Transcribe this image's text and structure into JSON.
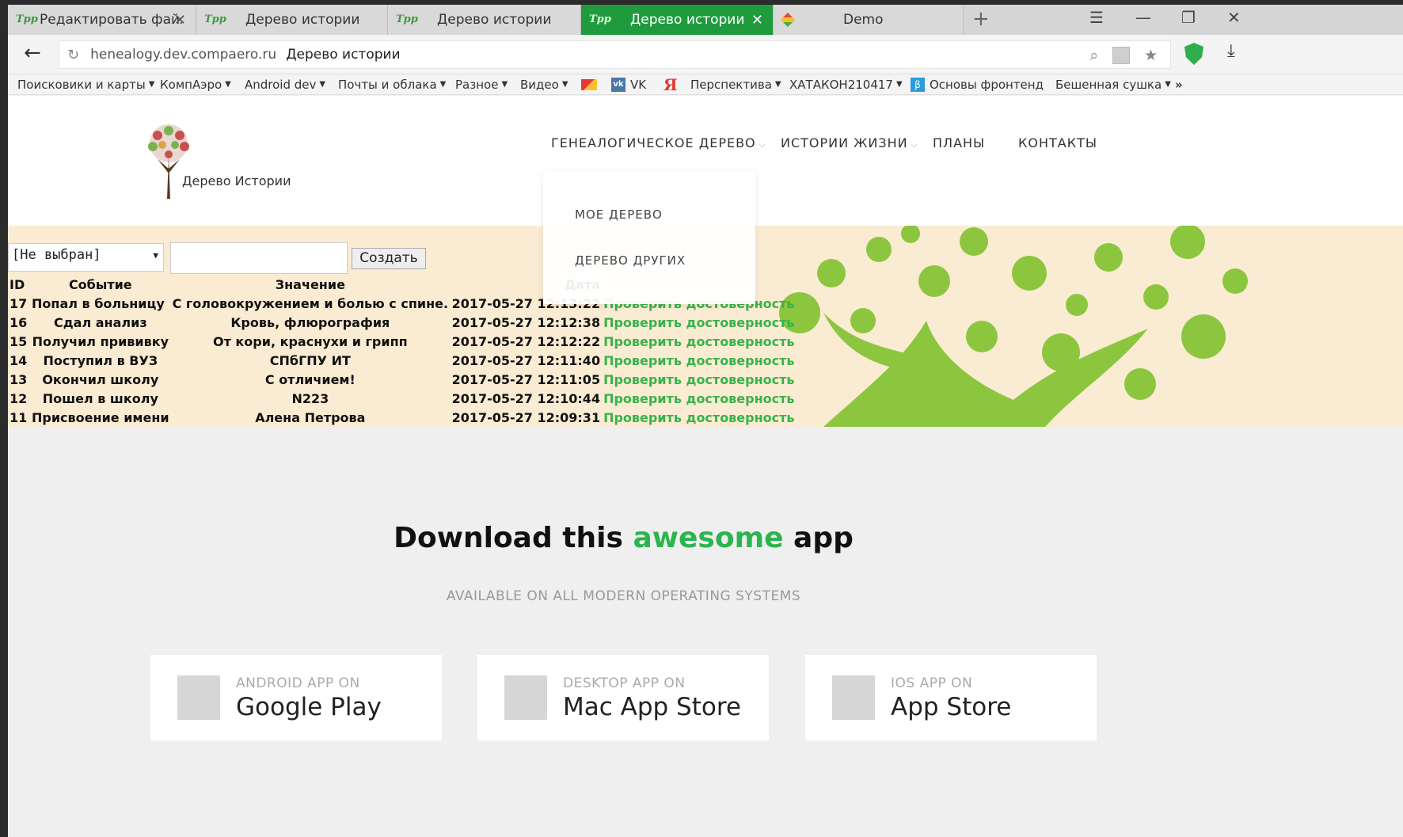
{
  "browser": {
    "tabs": [
      {
        "title": "Редактировать файл: styl",
        "closable": true
      },
      {
        "title": "Дерево истории",
        "closable": false
      },
      {
        "title": "Дерево истории",
        "closable": false
      },
      {
        "title": "Дерево истории",
        "closable": true,
        "active": true
      },
      {
        "title": "Demo",
        "closable": false
      }
    ],
    "url_domain": "henealogy.dev.compaero.ru",
    "url_title": "Дерево истории",
    "bookmarks": [
      {
        "label": "Поисковики и карты",
        "folder": true
      },
      {
        "label": "КомпАэро",
        "folder": true
      },
      {
        "label": "Android dev",
        "folder": true
      },
      {
        "label": "Почты и облака",
        "folder": true
      },
      {
        "label": "Разное",
        "folder": true
      },
      {
        "label": "Видео",
        "folder": true
      },
      {
        "label": "VK",
        "folder": false
      },
      {
        "label": "Я",
        "folder": false
      },
      {
        "label": "Перспектива",
        "folder": true
      },
      {
        "label": "ХАТАКОН210417",
        "folder": true
      },
      {
        "label": "Основы фронтенд",
        "folder": false
      },
      {
        "label": "Бешенная сушка",
        "folder": true
      },
      {
        "label": "»",
        "folder": false
      }
    ]
  },
  "site": {
    "logo_text": "Дерево Истории",
    "nav": [
      {
        "label": "ГЕНЕАЛОГИЧЕСКОЕ ДЕРЕВО",
        "has_dropdown": true
      },
      {
        "label": "ИСТОРИИ ЖИЗНИ",
        "has_dropdown": true
      },
      {
        "label": "ПЛАНЫ",
        "has_dropdown": false
      },
      {
        "label": "КОНТАКТЫ",
        "has_dropdown": false
      }
    ],
    "dropdown_items": [
      "МОЕ ДЕРЕВО",
      "ДЕРЕВО ДРУГИХ"
    ]
  },
  "events": {
    "select_value": "[Не выбран]",
    "create_label": "Создать",
    "columns": [
      "ID",
      "Событие",
      "Значение",
      "Дата"
    ],
    "rows": [
      {
        "id": "17",
        "event": "Попал в больницу",
        "value": "С головокружением и болью с спине.",
        "date": "2017-05-27 12:13:22",
        "action": "Проверить достоверность"
      },
      {
        "id": "16",
        "event": "Сдал анализ",
        "value": "Кровь, флюрография",
        "date": "2017-05-27 12:12:38",
        "action": "Проверить достоверность"
      },
      {
        "id": "15",
        "event": "Получил прививку",
        "value": "От кори, краснухи и грипп",
        "date": "2017-05-27 12:12:22",
        "action": "Проверить достоверность"
      },
      {
        "id": "14",
        "event": "Поступил в ВУЗ",
        "value": "СПбГПУ ИТ",
        "date": "2017-05-27 12:11:40",
        "action": "Проверить достоверность"
      },
      {
        "id": "13",
        "event": "Окончил школу",
        "value": "С отличием!",
        "date": "2017-05-27 12:11:05",
        "action": "Проверить достоверность"
      },
      {
        "id": "12",
        "event": "Пошел в школу",
        "value": "N223",
        "date": "2017-05-27 12:10:44",
        "action": "Проверить достоверность"
      },
      {
        "id": "11",
        "event": "Присвоение имени",
        "value": "Алена Петрова",
        "date": "2017-05-27 12:09:31",
        "action": "Проверить достоверность"
      }
    ]
  },
  "download": {
    "heading_pre": "Download this",
    "heading_accent": "awesome",
    "heading_post": "app",
    "subtitle": "AVAILABLE ON ALL MODERN OPERATING SYSTEMS",
    "accent_color": "#2cb44f",
    "cards": [
      {
        "small": "ANDROID APP ON",
        "big": "Google Play"
      },
      {
        "small": "DESKTOP APP ON",
        "big": "Mac App Store"
      },
      {
        "small": "IOS APP ON",
        "big": "App Store"
      }
    ]
  }
}
